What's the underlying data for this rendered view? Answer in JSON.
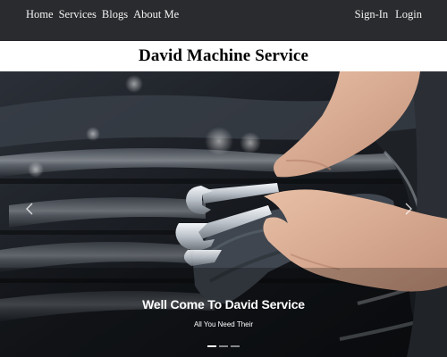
{
  "nav": {
    "left": [
      {
        "label": "Home"
      },
      {
        "label": "Services"
      },
      {
        "label": "Blogs"
      },
      {
        "label": "About Me"
      }
    ],
    "right": [
      {
        "label": "Sign-In"
      },
      {
        "label": "Login"
      }
    ]
  },
  "site_title": "David Machine Service",
  "hero": {
    "caption_title": "Well Come To David Service",
    "caption_subtitle": "All You Need Their",
    "active_slide": 1,
    "slide_count": 3
  },
  "icons": {
    "prev": "chevron-left-icon",
    "next": "chevron-right-icon"
  },
  "colors": {
    "navbar_bg": "#2a2b2e",
    "nav_text": "#f2f2f2",
    "title_text": "#000000",
    "hero_bg": "#15181c",
    "caption_text": "#ffffff"
  }
}
